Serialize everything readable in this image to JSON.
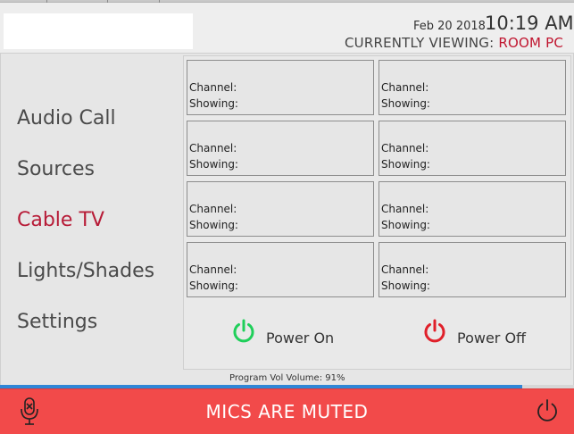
{
  "header": {
    "date": "Feb 20 2018",
    "time": "10:19 AM",
    "viewing_label": "CURRENTLY VIEWING:",
    "viewing_room": "ROOM PC"
  },
  "nav": {
    "items": [
      {
        "label": "Audio Call",
        "active": false
      },
      {
        "label": "Sources",
        "active": false
      },
      {
        "label": "Cable TV",
        "active": true
      },
      {
        "label": "Lights/Shades",
        "active": false
      },
      {
        "label": "Settings",
        "active": false
      }
    ]
  },
  "channels": {
    "channel_label": "Channel:",
    "showing_label": "Showing:",
    "tiles": [
      {
        "channel": "",
        "showing": ""
      },
      {
        "channel": "",
        "showing": ""
      },
      {
        "channel": "",
        "showing": ""
      },
      {
        "channel": "",
        "showing": ""
      },
      {
        "channel": "",
        "showing": ""
      },
      {
        "channel": "",
        "showing": ""
      },
      {
        "channel": "",
        "showing": ""
      },
      {
        "channel": "",
        "showing": ""
      }
    ]
  },
  "power": {
    "on_label": "Power On",
    "off_label": "Power Off",
    "on_color": "#1fcf5a",
    "off_color": "#e0202a"
  },
  "volume": {
    "label": "Program Vol Volume: 91%",
    "level": 0.91,
    "fill_color": "#2f86d6"
  },
  "status": {
    "mute_text": "MICS ARE MUTED",
    "bar_color": "#f24a4a"
  },
  "icons": {
    "mic": "mic-muted-icon",
    "system_power": "power-icon"
  }
}
